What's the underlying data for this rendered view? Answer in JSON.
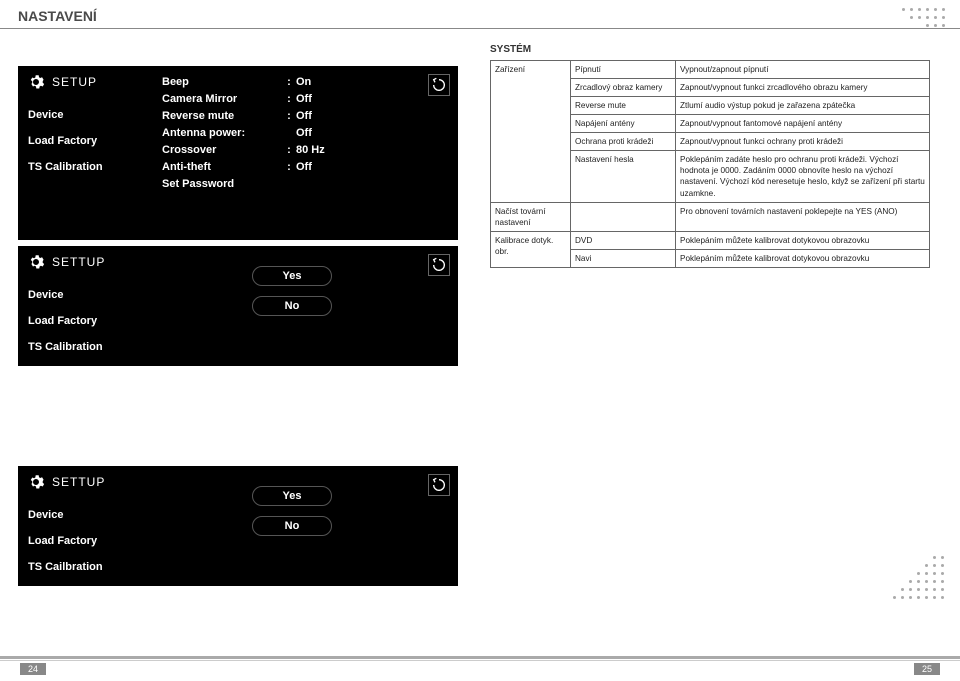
{
  "page": {
    "title": "NASTAVENÍ",
    "section_label": "SYSTÉM",
    "page_left": "24",
    "page_right": "25"
  },
  "panel1": {
    "title": "SETUP",
    "menu": {
      "device": "Device",
      "load_factory": "Load Factory",
      "ts_cal": "TS Calibration"
    },
    "rows": [
      {
        "k": "Beep",
        "s": ":",
        "v": "On"
      },
      {
        "k": "Camera Mirror",
        "s": ":",
        "v": "Off"
      },
      {
        "k": "Reverse mute",
        "s": ":",
        "v": "Off"
      },
      {
        "k": "Antenna power:",
        "s": "",
        "v": "Off"
      },
      {
        "k": "Crossover",
        "s": ":",
        "v": "80 Hz"
      },
      {
        "k": "Anti-theft",
        "s": ":",
        "v": "Off"
      },
      {
        "k": "Set Password",
        "s": "",
        "v": ""
      }
    ]
  },
  "panel2": {
    "title": "SETTUP",
    "menu": {
      "device": "Device",
      "load_factory": "Load Factory",
      "ts_cal": "TS Calibration"
    },
    "buttons": {
      "yes": "Yes",
      "no": "No"
    }
  },
  "panel3": {
    "title": "SETTUP",
    "menu": {
      "device": "Device",
      "load_factory": "Load Factory",
      "ts_cal": "TS Cailbration"
    },
    "buttons": {
      "yes": "Yes",
      "no": "No"
    }
  },
  "table": {
    "r1": {
      "c1": "Zařízení",
      "c2": "Pípnutí",
      "c3": "Vypnout/zapnout pípnutí"
    },
    "r2": {
      "c2": "Zrcadlový obraz kamery",
      "c3": "Zapnout/vypnout funkci zrcadlového obrazu kamery"
    },
    "r3": {
      "c2": "Reverse mute",
      "c3": "Ztlumí audio výstup pokud je zařazena zpátečka"
    },
    "r4": {
      "c2": "Napájení antény",
      "c3": "Zapnout/vypnout fantomové napájení antény"
    },
    "r5": {
      "c2": "Ochrana proti krádeži",
      "c3": "Zapnout/vypnout funkci ochrany proti krádeži"
    },
    "r6": {
      "c2": "Nastavení hesla",
      "c3": "Poklepáním zadáte heslo pro ochranu proti krádeži. Výchozí hodnota je 0000. Zadáním 0000 obnovíte heslo na výchozí nastavení. Výchozí kód neresetuje heslo, když se zařízení při startu uzamkne."
    },
    "r7": {
      "c1": "Načíst tovární nastavení",
      "c3": "Pro obnovení továrních nastavení poklepejte na YES (ANO)"
    },
    "r8": {
      "c1": "Kalibrace dotyk. obr.",
      "c2": "DVD",
      "c3": "Poklepáním můžete kalibrovat dotykovou obrazovku"
    },
    "r9": {
      "c2": "Navi",
      "c3": "Poklepáním můžete kalibrovat dotykovou obrazovku"
    }
  }
}
